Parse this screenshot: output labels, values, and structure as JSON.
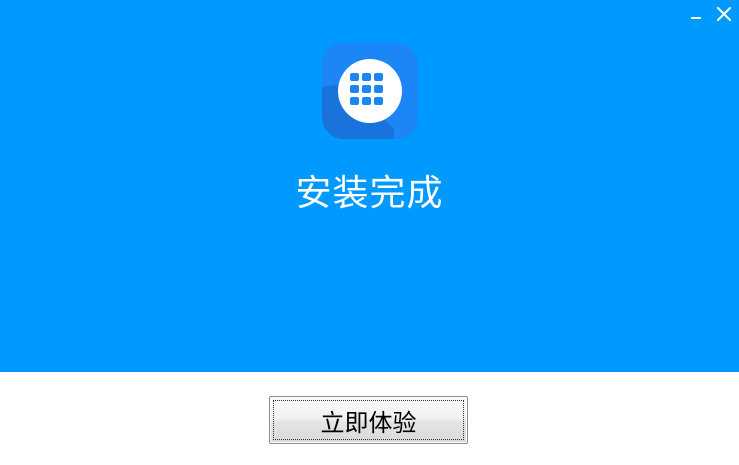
{
  "window": {
    "controls": {
      "minimize_icon": "minimize-icon",
      "close_icon": "close-icon"
    }
  },
  "header": {
    "background_color": "#0099fd",
    "app_icon": "keyboard-grid-icon",
    "title": "安装完成"
  },
  "footer": {
    "primary_button_label": "立即体验"
  }
}
